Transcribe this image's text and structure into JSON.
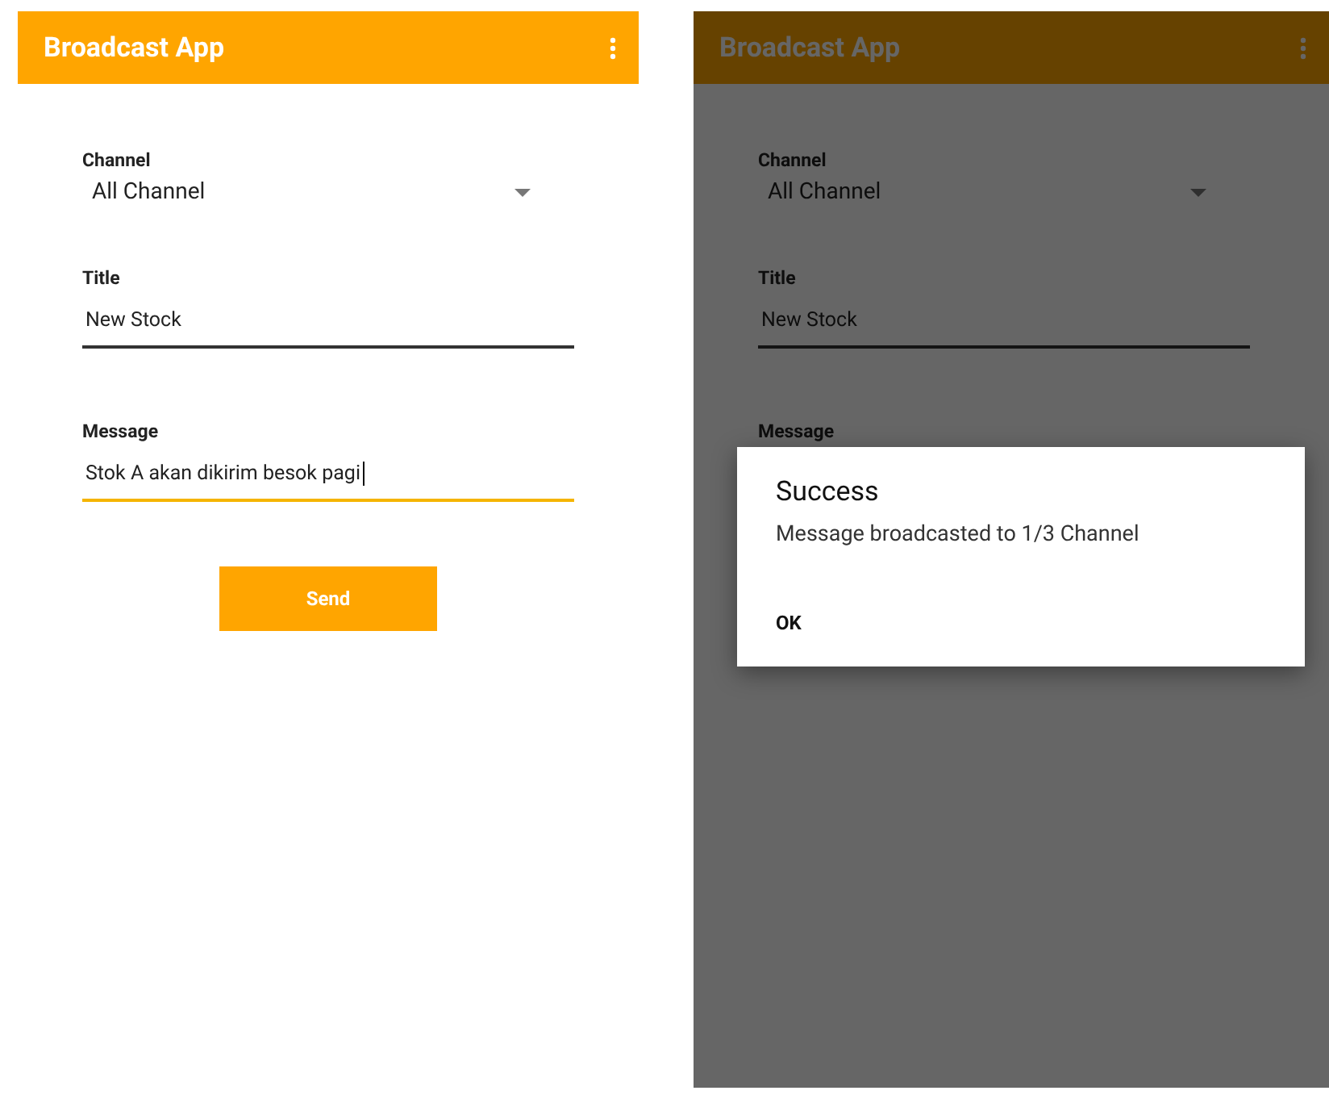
{
  "screens": [
    {
      "app_bar": {
        "title": "Broadcast App"
      },
      "channel": {
        "label": "Channel",
        "value": "All Channel"
      },
      "fields": [
        {
          "label": "Title",
          "value": "New Stock",
          "focused": false
        },
        {
          "label": "Message",
          "value": "Stok A akan dikirim besok pagi",
          "focused": true
        }
      ],
      "send_button": "Send"
    },
    {
      "app_bar": {
        "title": "Broadcast App"
      },
      "channel": {
        "label": "Channel",
        "value": "All Channel"
      },
      "fields": [
        {
          "label": "Title",
          "value": "New Stock",
          "focused": false
        },
        {
          "label": "Message"
        }
      ],
      "dialog": {
        "title": "Success",
        "message": "Message broadcasted to 1/3 Channel",
        "button": "OK"
      }
    }
  ]
}
